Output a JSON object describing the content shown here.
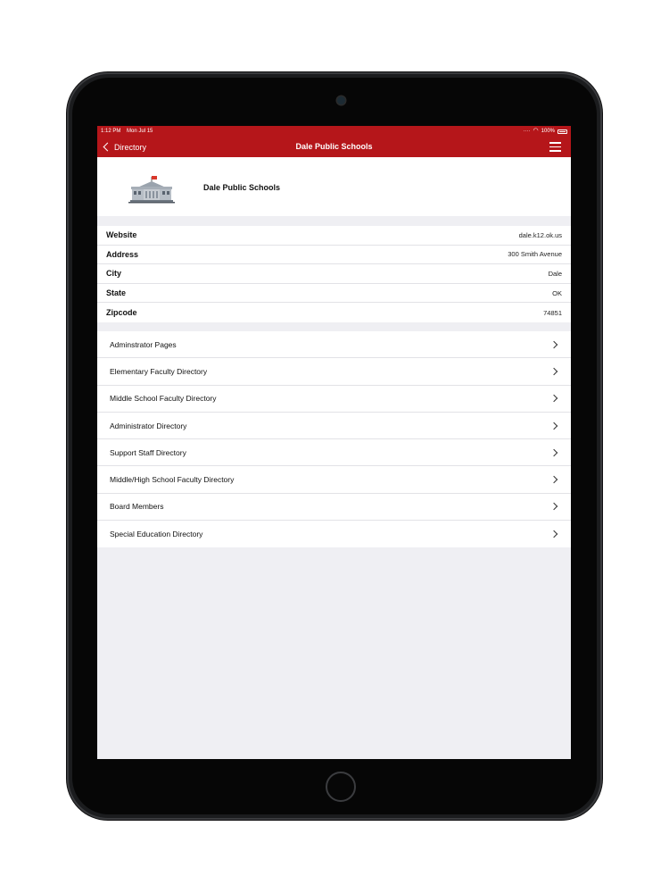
{
  "status_bar": {
    "time": "1:12 PM",
    "date": "Mon Jul 15",
    "battery": "100%",
    "wifi_icon": "wifi-icon",
    "battery_icon": "battery-icon"
  },
  "nav": {
    "back_label": "Directory",
    "title": "Dale Public Schools",
    "menu_icon": "hamburger-menu-icon"
  },
  "header": {
    "school_name": "Dale Public Schools",
    "icon": "school-building-icon"
  },
  "info": [
    {
      "label": "Website",
      "value": "dale.k12.ok.us"
    },
    {
      "label": "Address",
      "value": "300 Smith Avenue"
    },
    {
      "label": "City",
      "value": "Dale"
    },
    {
      "label": "State",
      "value": "OK"
    },
    {
      "label": "Zipcode",
      "value": "74851"
    }
  ],
  "directory_links": [
    {
      "label": "Adminstrator Pages"
    },
    {
      "label": "Elementary Faculty Directory"
    },
    {
      "label": "Middle School Faculty Directory"
    },
    {
      "label": "Administrator Directory"
    },
    {
      "label": "Support Staff Directory"
    },
    {
      "label": "Middle/High School Faculty Directory"
    },
    {
      "label": "Board Members"
    },
    {
      "label": "Special Education Directory"
    }
  ],
  "colors": {
    "accent": "#b5161a",
    "background": "#efeff3",
    "device": "#1b1c1e"
  }
}
